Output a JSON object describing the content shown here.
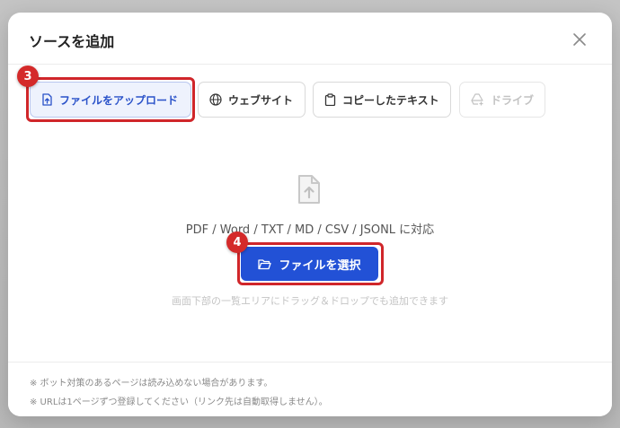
{
  "dialog": {
    "title": "ソースを追加",
    "close_icon": "close-icon"
  },
  "tabs": [
    {
      "label": "ファイルをアップロード",
      "icon": "file-upload-icon",
      "state": "active"
    },
    {
      "label": "ウェブサイト",
      "icon": "globe-icon",
      "state": "normal"
    },
    {
      "label": "コピーしたテキスト",
      "icon": "clipboard-icon",
      "state": "normal"
    },
    {
      "label": "ドライブ",
      "icon": "drive-icon",
      "state": "disabled"
    }
  ],
  "steps": {
    "upload_tab_step": "3",
    "select_button_step": "4"
  },
  "dropzone": {
    "icon": "file-upload-icon",
    "formats_text": "PDF / Word / TXT / MD / CSV / JSONL に対応",
    "select_button_label": "ファイルを選択",
    "select_button_icon": "folder-open-icon",
    "hint_text": "画面下部の一覧エリアにドラッグ＆ドロップでも追加できます"
  },
  "footer": {
    "notes": [
      "※ ボット対策のあるページは読み込めない場合があります。",
      "※ URLは1ページずつ登録してください（リンク先は自動取得しません）。"
    ]
  },
  "colors": {
    "accent": "#2251d6",
    "highlight": "#d0262a",
    "active_tab_bg": "#eef2fd"
  }
}
